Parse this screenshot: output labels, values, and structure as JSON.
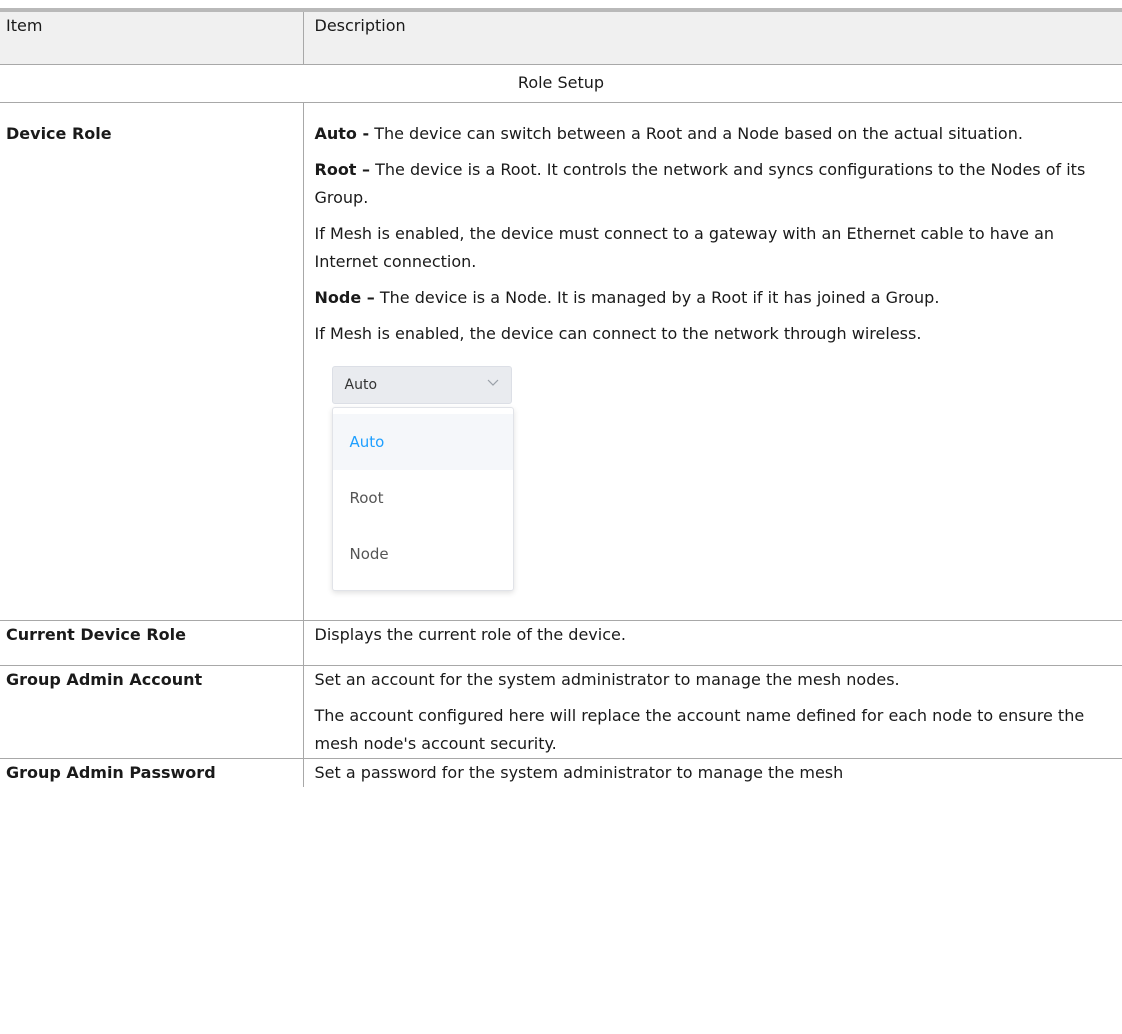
{
  "table": {
    "headers": {
      "item": "Item",
      "description": "Description"
    },
    "section_title": "Role Setup",
    "rows": {
      "device_role": {
        "item": "Device Role",
        "paragraphs": [
          {
            "lead": "Auto -",
            "text": " The device can switch between a Root and a Node based on the actual situation."
          },
          {
            "lead": "Root –",
            "text": " The device is a Root. It controls the network and syncs configurations to the Nodes of its Group."
          },
          {
            "lead": "",
            "text": "If Mesh is enabled, the device must connect to a gateway with an Ethernet cable to have an Internet connection."
          },
          {
            "lead": "Node –",
            "text": " The device is a Node. It is managed by a Root if it has joined a Group."
          },
          {
            "lead": "",
            "text": "If Mesh is enabled, the device can connect to the network through wireless."
          }
        ],
        "dropdown": {
          "selected": "Auto",
          "options": [
            "Auto",
            "Root",
            "Node"
          ],
          "highlight_color": "#1e9fff"
        }
      },
      "current_device_role": {
        "item": "Current Device Role",
        "text": "Displays the current role of the device."
      },
      "group_admin_account": {
        "item": "Group Admin Account",
        "paragraphs": [
          "Set an account for the system administrator to manage the mesh nodes.",
          "The account configured here will replace the account name defined for each node to ensure the mesh node's account security."
        ]
      },
      "group_admin_password": {
        "item": "Group Admin Password",
        "text": "Set a password for the system administrator to manage the mesh"
      }
    }
  }
}
